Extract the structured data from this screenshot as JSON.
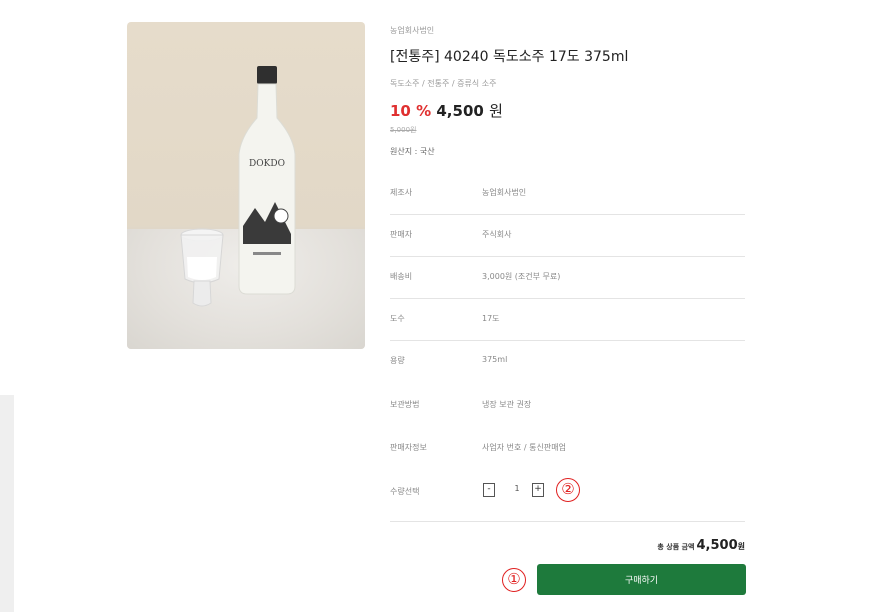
{
  "product": {
    "brand": "농업회사법인",
    "title": "[전통주] 40240 독도소주 17도 375ml",
    "subtitle": "독도소주 / 전통주 / 증류식 소주",
    "discount": "10 %",
    "price": "4,500",
    "price_unit": "원",
    "original_price": "5,000원",
    "origin": "원산지 : 국산",
    "bottle_label": "DOKDO"
  },
  "info_rows": [
    {
      "label": "제조사",
      "value": "농업회사법인"
    },
    {
      "label": "판매자",
      "value": "주식회사"
    },
    {
      "label": "배송비",
      "value": "3,000원 (조건부 무료)"
    },
    {
      "label": "도수",
      "value": "17도"
    },
    {
      "label": "용량",
      "value": "375ml"
    },
    {
      "label": "보관방법",
      "value": "냉장 보관 권장"
    },
    {
      "label": "판매자정보",
      "value": "사업자 번호 / 통신판매업"
    }
  ],
  "quantity": {
    "label": "수량선택",
    "minus": "-",
    "value": "1",
    "plus": "+"
  },
  "total": {
    "label": "총 상품 금액",
    "amount": "4,500",
    "unit": "원"
  },
  "buy_button": "구매하기",
  "markers": [
    "①",
    "②"
  ],
  "colors": {
    "accent_green": "#1e7a3c",
    "discount_red": "#e03030",
    "marker_red": "#e02020"
  }
}
